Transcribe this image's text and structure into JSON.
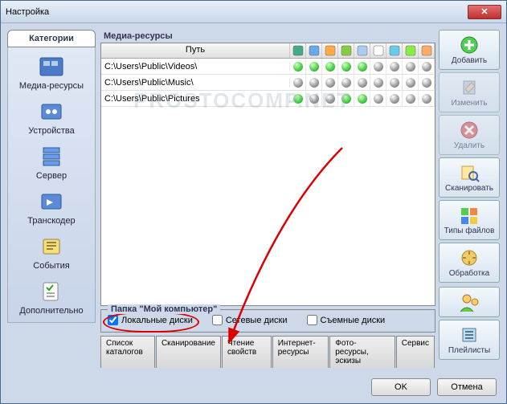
{
  "window": {
    "title": "Настройка"
  },
  "sidebar": {
    "title": "Категории",
    "items": [
      {
        "label": "Медиа-ресурсы",
        "name": "sidebar-item-media"
      },
      {
        "label": "Устройства",
        "name": "sidebar-item-devices"
      },
      {
        "label": "Сервер",
        "name": "sidebar-item-server"
      },
      {
        "label": "Транскодер",
        "name": "sidebar-item-transcoder"
      },
      {
        "label": "События",
        "name": "sidebar-item-events"
      },
      {
        "label": "Дополнительно",
        "name": "sidebar-item-advanced"
      }
    ]
  },
  "section": {
    "title": "Медиа-ресурсы"
  },
  "table": {
    "path_header": "Путь",
    "icon_cols": 9,
    "rows": [
      {
        "path": "C:\\Users\\Public\\Videos\\",
        "green": [
          0,
          1,
          2,
          3,
          4
        ]
      },
      {
        "path": "C:\\Users\\Public\\Music\\",
        "green": []
      },
      {
        "path": "C:\\Users\\Public\\Pictures",
        "green": [
          0,
          3,
          4
        ]
      }
    ]
  },
  "group": {
    "title": "Папка \"Мой компьютер\"",
    "checks": [
      {
        "label": "Локальные диски",
        "checked": true,
        "name": "check-local"
      },
      {
        "label": "Сетевые диски",
        "checked": false,
        "name": "check-network"
      },
      {
        "label": "Съемные диски",
        "checked": false,
        "name": "check-removable"
      }
    ]
  },
  "tabs": [
    "Список каталогов",
    "Сканирование",
    "Чтение свойств",
    "Интернет-ресурсы",
    "Фото-ресурсы, эскизы",
    "Сервис"
  ],
  "rightbar": [
    {
      "label": "Добавить",
      "name": "add-button",
      "disabled": false
    },
    {
      "label": "Изменить",
      "name": "edit-button",
      "disabled": true
    },
    {
      "label": "Удалить",
      "name": "delete-button",
      "disabled": true
    },
    {
      "label": "Сканировать",
      "name": "scan-button",
      "disabled": false
    },
    {
      "label": "Типы файлов",
      "name": "filetypes-button",
      "disabled": false
    },
    {
      "label": "Обработка",
      "name": "processing-button",
      "disabled": false
    },
    {
      "label": "Плейлисты",
      "name": "playlists-button",
      "disabled": false
    }
  ],
  "footer": {
    "ok": "OK",
    "cancel": "Отмена"
  },
  "watermark": "PROSTOCOMP.NET"
}
